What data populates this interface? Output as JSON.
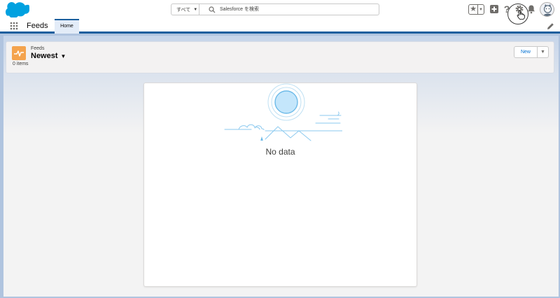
{
  "search": {
    "scope_label": "すべて",
    "placeholder": "Salesforce を検索"
  },
  "header_icons": {
    "favorites": "star-icon",
    "add": "plus-icon",
    "help": "question-icon",
    "setup": "gear-icon",
    "notifications": "bell-icon",
    "avatar": "avatar-icon"
  },
  "nav": {
    "app_name": "Feeds",
    "tabs": [
      {
        "label": "Home"
      }
    ]
  },
  "list_header": {
    "object_label": "Feeds",
    "view_name": "Newest",
    "item_count": "0 items",
    "new_button": "New"
  },
  "empty_state": {
    "message": "No data"
  },
  "colors": {
    "brand_blue": "#1b5f9e",
    "link_blue": "#0070d2",
    "object_icon": "#f4a34d",
    "salesforce_cloud": "#00a1e0"
  }
}
